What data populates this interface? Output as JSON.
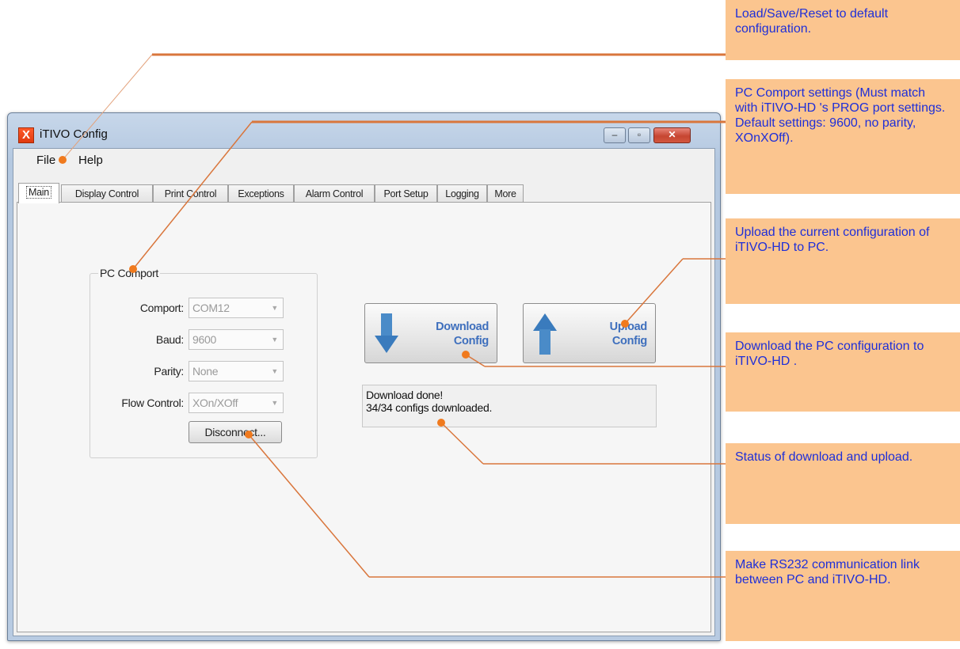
{
  "window": {
    "title": "iTIVO Config",
    "controls": {
      "minimize": "–",
      "maximize": "▫",
      "close": "✕"
    }
  },
  "menu": [
    "File",
    "Help"
  ],
  "tabs": [
    "Main",
    "Display Control",
    "Print Control",
    "Exceptions",
    "Alarm Control",
    "Port Setup",
    "Logging",
    "More"
  ],
  "active_tab": "Main",
  "pc_comport": {
    "group_title": "PC Comport",
    "fields": [
      {
        "label": "Comport:",
        "value": "COM12"
      },
      {
        "label": "Baud:",
        "value": "9600"
      },
      {
        "label": "Parity:",
        "value": "None"
      },
      {
        "label": "Flow Control:",
        "value": "XOn/XOff"
      }
    ],
    "disconnect_label": "Disconnect..."
  },
  "download_button": {
    "line1": "Download",
    "line2": "Config"
  },
  "upload_button": {
    "line1": "Upload",
    "line2": "Config"
  },
  "status": {
    "line1": "Download done!",
    "line2": "34/34 configs downloaded."
  },
  "annotations": [
    "Load/Save/Reset to default configuration.",
    "PC Comport settings (Must match with iTIVO-HD 's PROG port settings. Default settings: 9600, no parity, XOnXOff).",
    "Upload the current configuration of iTIVO-HD to PC.",
    "Download the PC configuration to iTIVO-HD .",
    "Status of download and upload.",
    "Make RS232 communication link between PC and iTIVO-HD."
  ],
  "colors": {
    "callout_bg": "#fbc58f",
    "callout_text": "#1f2fd8",
    "leader_line": "#d9763c",
    "marker_dot": "#f07a1e",
    "button_text": "#3e6fbd",
    "arrow_fill": "#4a8bc8"
  }
}
